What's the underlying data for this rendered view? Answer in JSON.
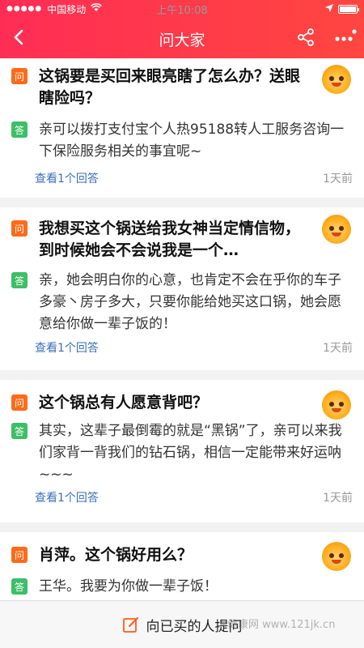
{
  "status_bar": {
    "carrier": "中国移动",
    "time": "上午10:08"
  },
  "nav": {
    "title": "问大家"
  },
  "cards": [
    {
      "tag_q": "问",
      "question": "这锅要是买回来眼亮瞎了怎么办？送眼瞎险吗？",
      "tag_a": "答",
      "answer": "亲可以拨打支付宝个人热95188转人工服务咨询一下保险服务相关的事宜呢~",
      "link": "查看1个回答",
      "time": "1天前"
    },
    {
      "tag_q": "问",
      "question": "我想买这个锅送给我女神当定情信物，到时候她会不会说我是一个…",
      "tag_a": "答",
      "answer": "亲，她会明白你的心意，也肯定不会在乎你的车子多豪丶房子多大，只要你能给她买这口锅，她会愿意给你做一辈子饭的！",
      "link": "查看1个回答",
      "time": "1天前"
    },
    {
      "tag_q": "问",
      "question": "这个锅总有人愿意背吧？",
      "tag_a": "答",
      "answer": "其实，这辈子最倒霉的就是“黑锅”了，亲可以来我们家背一背我们的钻石锅，相信一定能带来好运呐~~~",
      "link": "查看1个回答",
      "time": "1天前"
    },
    {
      "tag_q": "问",
      "question": "肖萍。这个锅好用么？",
      "tag_a": "答",
      "answer": "王华。我要为你做一辈子饭！"
    }
  ],
  "bottom": {
    "label": "向已买的人提问"
  },
  "watermark": "人健康网 www.121jk.cn",
  "colors": {
    "header": "#ff3347",
    "question_tag": "#ff6a1a",
    "answer_tag": "#3cbf66",
    "link": "#3a6fb8"
  }
}
